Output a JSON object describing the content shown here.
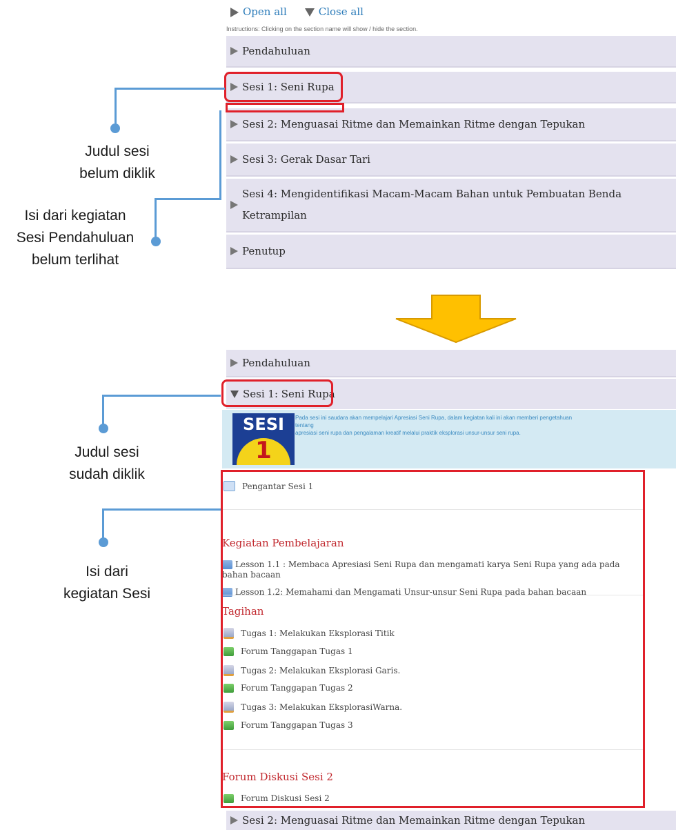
{
  "top": {
    "open_all": "Open all",
    "close_all": "Close all",
    "instructions": "Instructions: Clicking on the section name will show / hide the section.",
    "sections": [
      "Pendahuluan",
      "Sesi 1: Seni Rupa",
      "Sesi 2: Menguasai Ritme dan Memainkan Ritme dengan Tepukan",
      "Sesi 3: Gerak Dasar Tari",
      "Sesi 4: Mengidentifikasi Macam-Macam Bahan untuk Pembuatan Benda",
      "Ketrampilan",
      "Penutup"
    ]
  },
  "annotations": {
    "a1_line1": "Judul sesi",
    "a1_line2": "belum diklik",
    "a2_line1": "Isi dari kegiatan",
    "a2_line2": "Sesi Pendahuluan",
    "a2_line3": "belum terlihat",
    "a3_line1": "Judul sesi",
    "a3_line2": "sudah diklik",
    "a4_line1": "Isi dari",
    "a4_line2": "kegiatan Sesi"
  },
  "bottom": {
    "section_pendahuluan": "Pendahuluan",
    "section_sesi1": "Sesi 1: Seni Rupa",
    "banner_logo_word": "SESI",
    "banner_logo_num": "1",
    "banner_text_1": "Pada sesi ini saudara akan mempelajari Apresiasi Seni Rupa, dalam kegiatan kali ini akan memberi pengetahuan",
    "banner_text_2": "tentang",
    "banner_text_3": "apresiasi seni rupa dan pengalaman kreatif melalui praktik eksplorasi unsur-unsur seni rupa.",
    "pengantar": "Pengantar Sesi 1",
    "heading_kegiatan": "Kegiatan Pembelajaran",
    "lesson_1_1a": "Lesson 1.1 : Membaca Apresiasi Seni Rupa dan mengamati karya Seni Rupa yang ada pada",
    "lesson_1_1b": "bahan bacaan",
    "lesson_1_2": "Lesson 1.2: Memahami dan Mengamati Unsur-unsur Seni Rupa pada bahan bacaan",
    "heading_tagihan": "Tagihan",
    "tagihan": [
      "Tugas 1: Melakukan Eksplorasi Titik",
      "Forum Tanggapan Tugas 1",
      "Tugas 2: Melakukan Eksplorasi Garis.",
      "Forum Tanggapan Tugas 2",
      "Tugas 3: Melakukan EksplorasiWarna.",
      "Forum Tanggapan Tugas 3"
    ],
    "heading_forum": "Forum Diskusi Sesi 2",
    "forum_item": "Forum Diskusi Sesi 2",
    "section_sesi2": "Sesi 2: Menguasai Ritme dan Memainkan Ritme dengan Tepukan"
  },
  "colors": {
    "highlight_red": "#e0202a",
    "connector_blue": "#5b9bd5",
    "arrow_fill": "#ffc000",
    "section_bg": "#e4e2ef",
    "banner_bg": "#d4eaf3",
    "heading_red": "#c1272d"
  }
}
